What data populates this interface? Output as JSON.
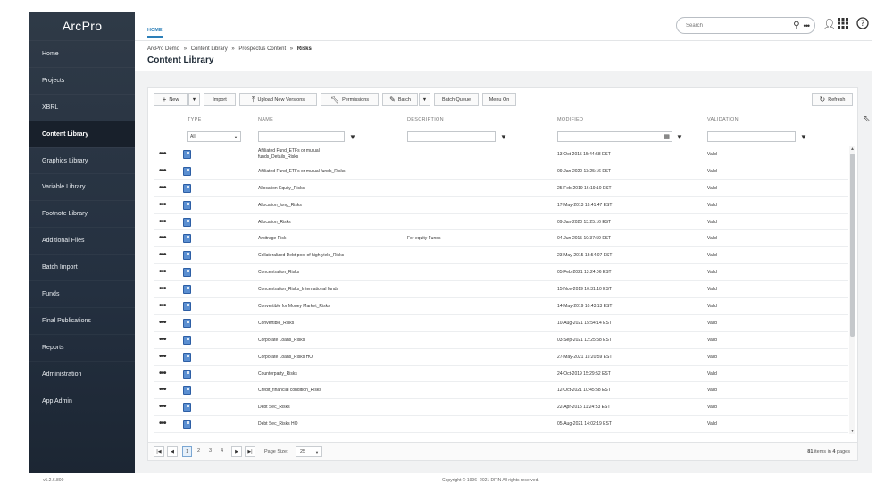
{
  "app": {
    "name": "ArcPro",
    "version": "v5.2.6.800"
  },
  "sidebar": {
    "items": [
      {
        "label": "Home",
        "active": false
      },
      {
        "label": "Projects",
        "active": false
      },
      {
        "label": "XBRL",
        "active": false
      },
      {
        "label": "Content Library",
        "active": true
      },
      {
        "label": "Graphics Library",
        "active": false
      },
      {
        "label": "Variable Library",
        "active": false
      },
      {
        "label": "Footnote Library",
        "active": false
      },
      {
        "label": "Additional Files",
        "active": false
      },
      {
        "label": "Batch Import",
        "active": false
      },
      {
        "label": "Funds",
        "active": false
      },
      {
        "label": "Final Publications",
        "active": false
      },
      {
        "label": "Reports",
        "active": false
      },
      {
        "label": "Administration",
        "active": false
      },
      {
        "label": "App Admin",
        "active": false
      }
    ]
  },
  "header": {
    "tab": "HOME",
    "search_placeholder": "Search",
    "icons": [
      "user-icon",
      "apps-grid-icon",
      "help-icon"
    ]
  },
  "breadcrumb": {
    "parts": [
      "ArcPro Demo",
      "Content Library",
      "Prospectus Content"
    ],
    "separator": "»",
    "current": "Risks"
  },
  "page_title": "Content Library",
  "toolbar": {
    "new": "New",
    "import": "Import",
    "upload": "Upload New Versions",
    "permissions": "Permissions",
    "batch": "Batch",
    "batch_queue": "Batch Queue",
    "menu_on": "Menu On",
    "refresh": "Refresh"
  },
  "columns": {
    "type": "TYPE",
    "name": "NAME",
    "description": "DESCRIPTION",
    "modified": "MODIFIED",
    "validation": "VALIDATION"
  },
  "filters": {
    "type_value": "All"
  },
  "rows": [
    {
      "name": "Affiliated Fund_ETFs or mutual funds_Details_Risks",
      "name_l1": "Affiliated Fund_ETFs or mutual",
      "name_l2": "funds_Details_Risks",
      "description": "",
      "modified": "13-Oct-2015 15:44:58 EST",
      "validation": "Valid"
    },
    {
      "name": "Affiliated Fund_ETFs or mutual funds_Risks",
      "name_l1": "Affiliated Fund_ETFs or mutual funds_Risks",
      "name_l2": "",
      "description": "",
      "modified": "09-Jan-2020 13:25:16 EST",
      "validation": "Valid"
    },
    {
      "name": "Allocation Equity_Risks",
      "name_l1": "Allocation Equity_Risks",
      "name_l2": "",
      "description": "",
      "modified": "25-Feb-2019 16:19:10 EST",
      "validation": "Valid"
    },
    {
      "name": "Allocation_long_Risks",
      "name_l1": "Allocation_long_Risks",
      "name_l2": "",
      "description": "",
      "modified": "17-May-2013 13:41:47 EST",
      "validation": "Valid"
    },
    {
      "name": "Allocation_Risks",
      "name_l1": "Allocation_Risks",
      "name_l2": "",
      "description": "",
      "modified": "09-Jan-2020 13:25:16 EST",
      "validation": "Valid"
    },
    {
      "name": "Arbitrage Risk",
      "name_l1": "Arbitrage Risk",
      "name_l2": "",
      "description": "For equity Funds",
      "modified": "04-Jun-2015 10:37:59 EST",
      "validation": "Valid"
    },
    {
      "name": "Collateralized Debt pool of high yield_Risks",
      "name_l1": "Collateralized Debt pool of high yield_Risks",
      "name_l2": "",
      "description": "",
      "modified": "23-May-2015 13:54:07 EST",
      "validation": "Valid"
    },
    {
      "name": "Concentration_Risks",
      "name_l1": "Concentration_Risks",
      "name_l2": "",
      "description": "",
      "modified": "05-Feb-2021 13:24:06 EST",
      "validation": "Valid"
    },
    {
      "name": "Concentration_Risks_International funds",
      "name_l1": "Concentration_Risks_International funds",
      "name_l2": "",
      "description": "",
      "modified": "15-Nov-2019 10:31:10 EST",
      "validation": "Valid"
    },
    {
      "name": "Convertible for Money Market_Risks",
      "name_l1": "Convertible for Money Market_Risks",
      "name_l2": "",
      "description": "",
      "modified": "14-May-2019 10:43:13 EST",
      "validation": "Valid"
    },
    {
      "name": "Convertible_Risks",
      "name_l1": "Convertible_Risks",
      "name_l2": "",
      "description": "",
      "modified": "10-Aug-2021 15:54:14 EST",
      "validation": "Valid"
    },
    {
      "name": "Corporate Loans_Risks",
      "name_l1": "Corporate Loans_Risks",
      "name_l2": "",
      "description": "",
      "modified": "03-Sep-2021 12:25:58 EST",
      "validation": "Valid"
    },
    {
      "name": "Corporate Loans_Risks HO",
      "name_l1": "Corporate Loans_Risks HO",
      "name_l2": "",
      "description": "",
      "modified": "27-May-2021 15:20:59 EST",
      "validation": "Valid"
    },
    {
      "name": "Counterparty_Risks",
      "name_l1": "Counterparty_Risks",
      "name_l2": "",
      "description": "",
      "modified": "24-Oct-2019 15:29:52 EST",
      "validation": "Valid"
    },
    {
      "name": "Credit_financial condition_Risks",
      "name_l1": "Credit_financial condition_Risks",
      "name_l2": "",
      "description": "",
      "modified": "12-Oct-2021 10:45:58 EST",
      "validation": "Valid"
    },
    {
      "name": "Debt Sec_Risks",
      "name_l1": "Debt Sec_Risks",
      "name_l2": "",
      "description": "",
      "modified": "22-Apr-2015 11:24:53 EST",
      "validation": "Valid"
    },
    {
      "name": "Debt Sec_Risks HO",
      "name_l1": "Debt Sec_Risks HO",
      "name_l2": "",
      "description": "",
      "modified": "05-Aug-2021 14:02:19 EST",
      "validation": "Valid"
    }
  ],
  "pager": {
    "pages": [
      "1",
      "2",
      "3",
      "4"
    ],
    "current_page": "1",
    "page_size_label": "Page Size:",
    "page_size": "25",
    "total_items": "81",
    "items_in": "items in",
    "total_pages": "4",
    "pages_word": "pages"
  },
  "footer": {
    "copyright": "Copyright © 1996- 2021 DFIN All rights reserved."
  },
  "colors": {
    "sidebar": "#243040",
    "accent": "#2c7fb8",
    "doc_icon": "#5b8fd1"
  }
}
